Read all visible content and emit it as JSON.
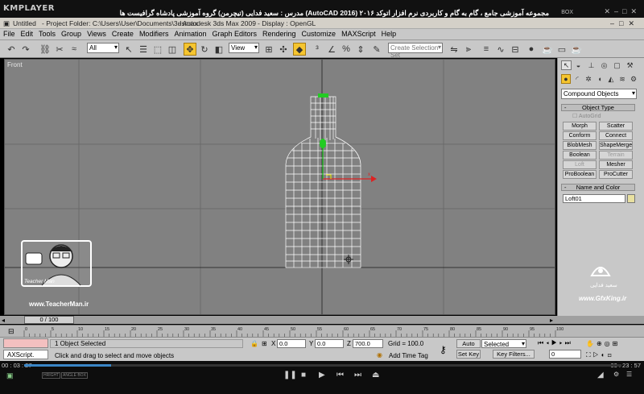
{
  "player": {
    "name": "KMPLAYER",
    "video_title": "مجموعه آموزشی جامع ، گام به گام و کاربردی نرم افزار اتوکد ۲۰۱۶ (AutoCAD 2016) مدرس : سعید فدایی (تیچرمن) گروه آموزشی پادشاه گرافیست ها",
    "box_label": "BOX",
    "time_current": "00 : 03 : 27",
    "time_total": "00 : 23 : 57",
    "progress_fraction": 0.145,
    "bottom_tags": [
      "HRIGHT",
      "ANGLE BOX"
    ]
  },
  "max": {
    "untitled": "Untitled",
    "project_folder": "- Project Folder: C:\\Users\\User\\Documents\\3dsmax",
    "app_title": "- Autodesk 3ds Max  2009",
    "display": "- Display : OpenGL",
    "menu": [
      "File",
      "Edit",
      "Tools",
      "Group",
      "Views",
      "Create",
      "Modifiers",
      "Animation",
      "Graph Editors",
      "Rendering",
      "Customize",
      "MAXScript",
      "Help"
    ],
    "selection_filter": "All",
    "ref_coord": "View",
    "named_selection_placeholder": "Create Selection Set",
    "viewport_label": "Front"
  },
  "panel": {
    "category": "Compound Objects",
    "rollout_object_type": "Object Type",
    "autogrid": "AutoGrid",
    "buttons": [
      "Morph",
      "Scatter",
      "Conform",
      "Connect",
      "BlobMesh",
      "ShapeMerge",
      "Boolean",
      "Terrain",
      "Loft",
      "Mesher",
      "ProBoolean",
      "ProCutter"
    ],
    "disabled": [
      "Terrain",
      "Loft"
    ],
    "rollout_name_color": "Name and Color",
    "object_name": "Loft01"
  },
  "timeline": {
    "frame": "0 / 100",
    "ticks": [
      "0",
      "5",
      "10",
      "15",
      "20",
      "25",
      "30",
      "35",
      "40",
      "45",
      "50",
      "55",
      "60",
      "65",
      "70",
      "75",
      "80",
      "85",
      "90",
      "95",
      "100"
    ]
  },
  "status": {
    "listener": "AXScript.",
    "selected": "1 Object Selected",
    "prompt": "Click and drag to select and move objects",
    "x": "0.0",
    "y": "0.0",
    "z": "700.0",
    "grid": "Grid = 100.0",
    "add_time_tag": "Add Time Tag",
    "auto_key": "Auto Key",
    "auto_key_mode": "Selected",
    "set_key": "Set Key",
    "key_filters": "Key Filters...",
    "current_frame": "0"
  },
  "watermark": {
    "site": "www.TeacherMan.ir",
    "avatar_caption": "Teacher Man",
    "right_name": "سعید فدایی",
    "right_site": "www.GfxKing.ir"
  },
  "colors": {
    "accent": "#f5c530",
    "viewport_bg": "#818181",
    "ui_gray": "#c8c8c8",
    "mesh": "#ffffff",
    "gizmo_green": "#22cc22",
    "gizmo_red": "#dd2222",
    "progress": "#3b86c6"
  }
}
